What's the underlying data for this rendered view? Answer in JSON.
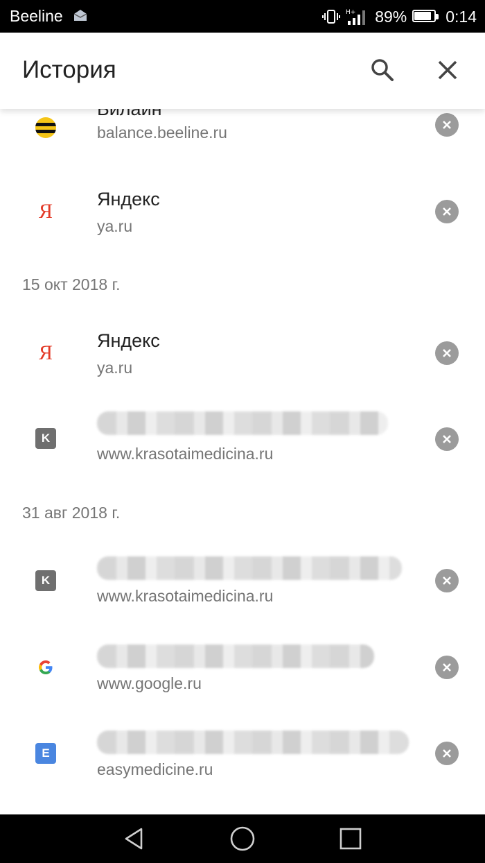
{
  "status_bar": {
    "carrier": "Beeline",
    "battery": "89%",
    "time": "0:14",
    "network_label": "H+",
    "icons": [
      "mail-icon",
      "vibrate-icon",
      "signal-icon",
      "battery-icon"
    ]
  },
  "app_bar": {
    "title": "История",
    "icons": [
      "search-icon",
      "close-icon"
    ]
  },
  "history": {
    "items_top": [
      {
        "title": "Билайн",
        "url": "balance.beeline.ru",
        "favicon": "beeline-icon"
      },
      {
        "title": "Яндекс",
        "url": "ya.ru",
        "favicon": "yandex-icon",
        "fav_letter": "Я"
      }
    ],
    "section_oct": {
      "date": "15 окт 2018 г.",
      "items": [
        {
          "title": "Яндекс",
          "url": "ya.ru",
          "favicon": "yandex-icon",
          "fav_letter": "Я"
        },
        {
          "url": "www.krasotaimedicina.ru",
          "favicon": "k-letter-icon",
          "fav_letter": "K"
        }
      ]
    },
    "section_aug": {
      "date": "31 авг 2018 г.",
      "items": [
        {
          "url": "www.krasotaimedicina.ru",
          "favicon": "k-letter-icon",
          "fav_letter": "K"
        },
        {
          "url": "www.google.ru",
          "favicon": "google-icon"
        },
        {
          "url": "easymedicine.ru",
          "favicon": "e-letter-icon",
          "fav_letter": "E"
        }
      ]
    }
  },
  "colors": {
    "yandex_red": "#e33a27",
    "beeline_yellow": "#f5c517",
    "delete_gray": "#9b9b9b",
    "e_favicon_blue": "#4a86e0",
    "k_favicon_gray": "#6f6f6f"
  },
  "nav_bar": {
    "icons": [
      "back-icon",
      "home-icon",
      "recents-icon"
    ]
  }
}
